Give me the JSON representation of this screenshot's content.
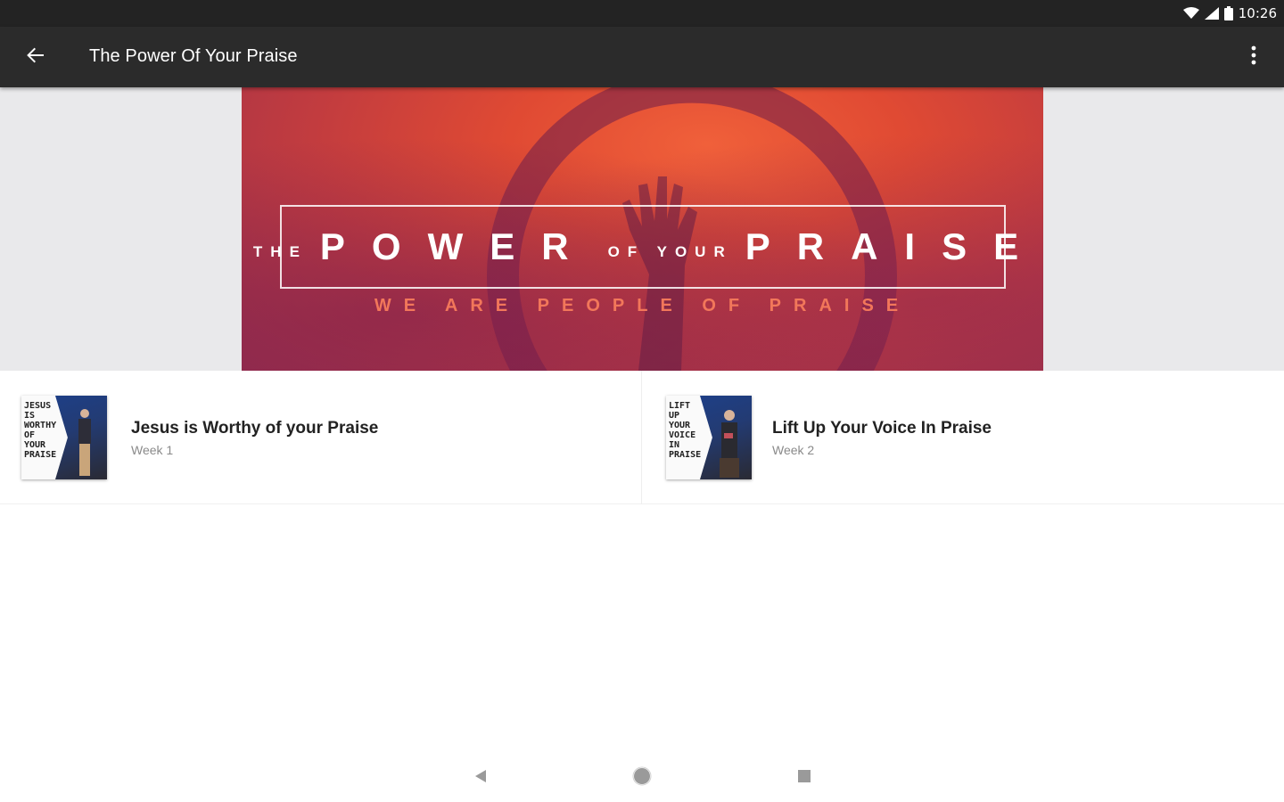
{
  "status_bar": {
    "time": "10:26",
    "icons": [
      "wifi-icon",
      "cell-signal-icon",
      "battery-icon"
    ]
  },
  "app_bar": {
    "title": "The Power Of Your Praise",
    "back_icon": "arrow-back-icon",
    "menu_icon": "more-vert-icon"
  },
  "banner": {
    "title_prefix": "THE",
    "title_word1": "POWER",
    "title_middle": "OF YOUR",
    "title_word2": "PRAISE",
    "subtitle": "WE ARE PEOPLE OF PRAISE"
  },
  "series": {
    "items": [
      {
        "title": "Jesus is Worthy of your Praise",
        "subtitle": "Week 1",
        "thumb_text": "JESUS IS WORTHY OF YOUR PRAISE"
      },
      {
        "title": "Lift Up Your Voice In Praise",
        "subtitle": "Week 2",
        "thumb_text": "LIFT UP YOUR VOICE IN PRAISE"
      }
    ]
  },
  "nav_bar": {
    "icons": [
      "back-triangle-icon",
      "home-circle-icon",
      "recents-square-icon"
    ]
  },
  "colors": {
    "app_bar": "#2b2b2b",
    "status_bar": "#232323",
    "banner_accent": "#e04a33",
    "banner_subtitle": "#f2775a"
  }
}
